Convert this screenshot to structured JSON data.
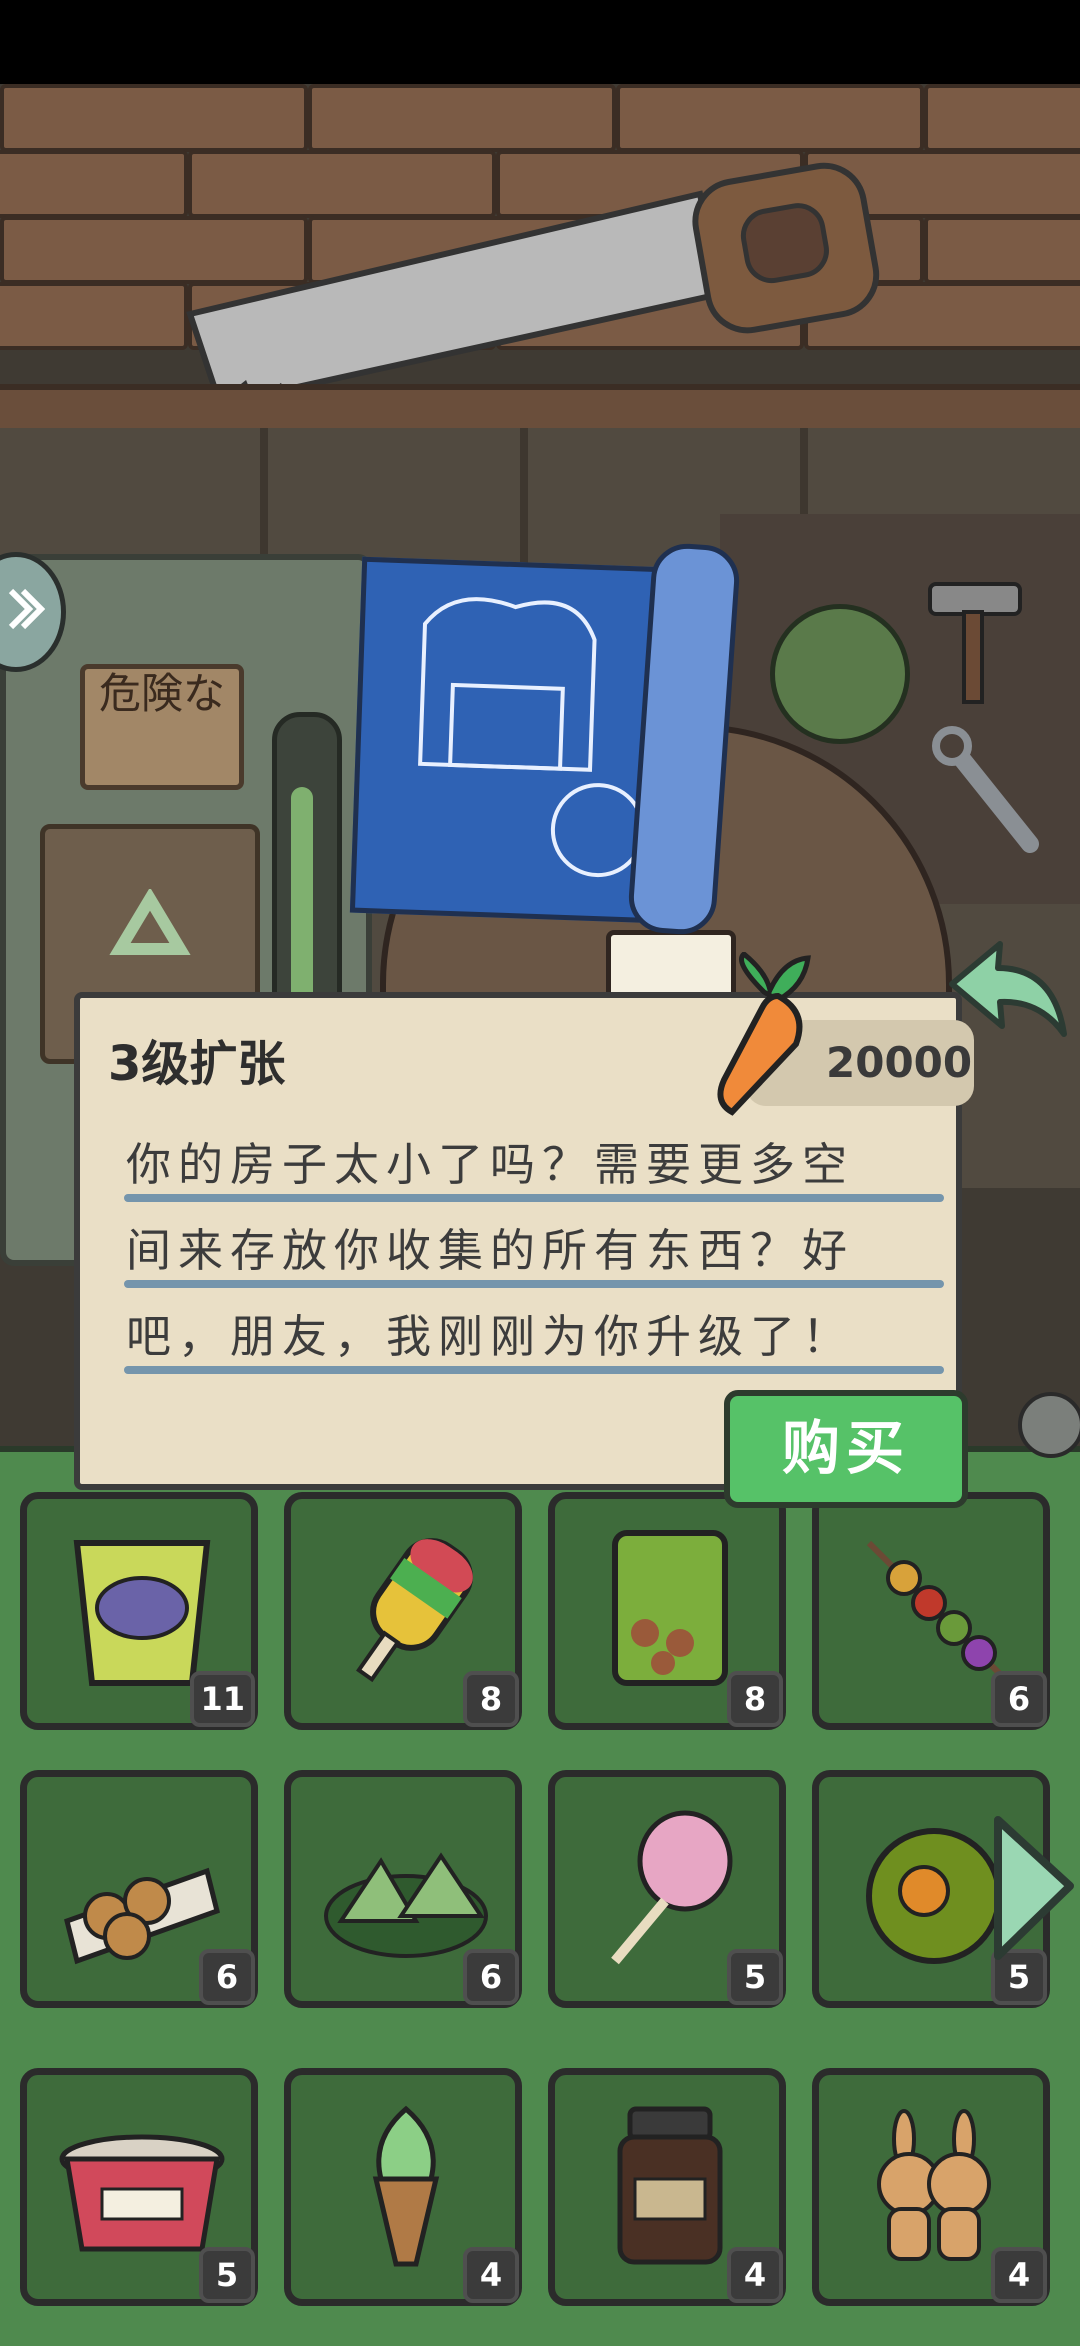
{
  "dialog": {
    "title": "3级扩张",
    "price": "20000",
    "description_lines": [
      "你的房子太小了吗？需要更多空",
      "间来存放你收集的所有东西？好",
      "吧，朋友，我刚刚为你升级了！"
    ],
    "buy_label": "购买"
  },
  "scene": {
    "danger_sign": "危険な"
  },
  "inventory": {
    "items": [
      {
        "name": "cup-noodles",
        "count": "11"
      },
      {
        "name": "popsicle",
        "count": "8"
      },
      {
        "name": "chips-bag",
        "count": "8"
      },
      {
        "name": "skewer",
        "count": "6"
      },
      {
        "name": "takoyaki",
        "count": "6"
      },
      {
        "name": "rice-cakes",
        "count": "6"
      },
      {
        "name": "cotton-candy",
        "count": "5"
      },
      {
        "name": "coconut",
        "count": "5"
      },
      {
        "name": "instant-ramen-bowl",
        "count": "5"
      },
      {
        "name": "taiyaki-ice-cream",
        "count": "4"
      },
      {
        "name": "coffee-jar",
        "count": "4"
      },
      {
        "name": "gingerbread-rabbits",
        "count": "4"
      }
    ]
  },
  "colors": {
    "buy_button": "#56c268",
    "inventory_bg": "#4f8a4e",
    "dialog_bg": "#eadfc6",
    "carrot": "#f08a3a"
  }
}
